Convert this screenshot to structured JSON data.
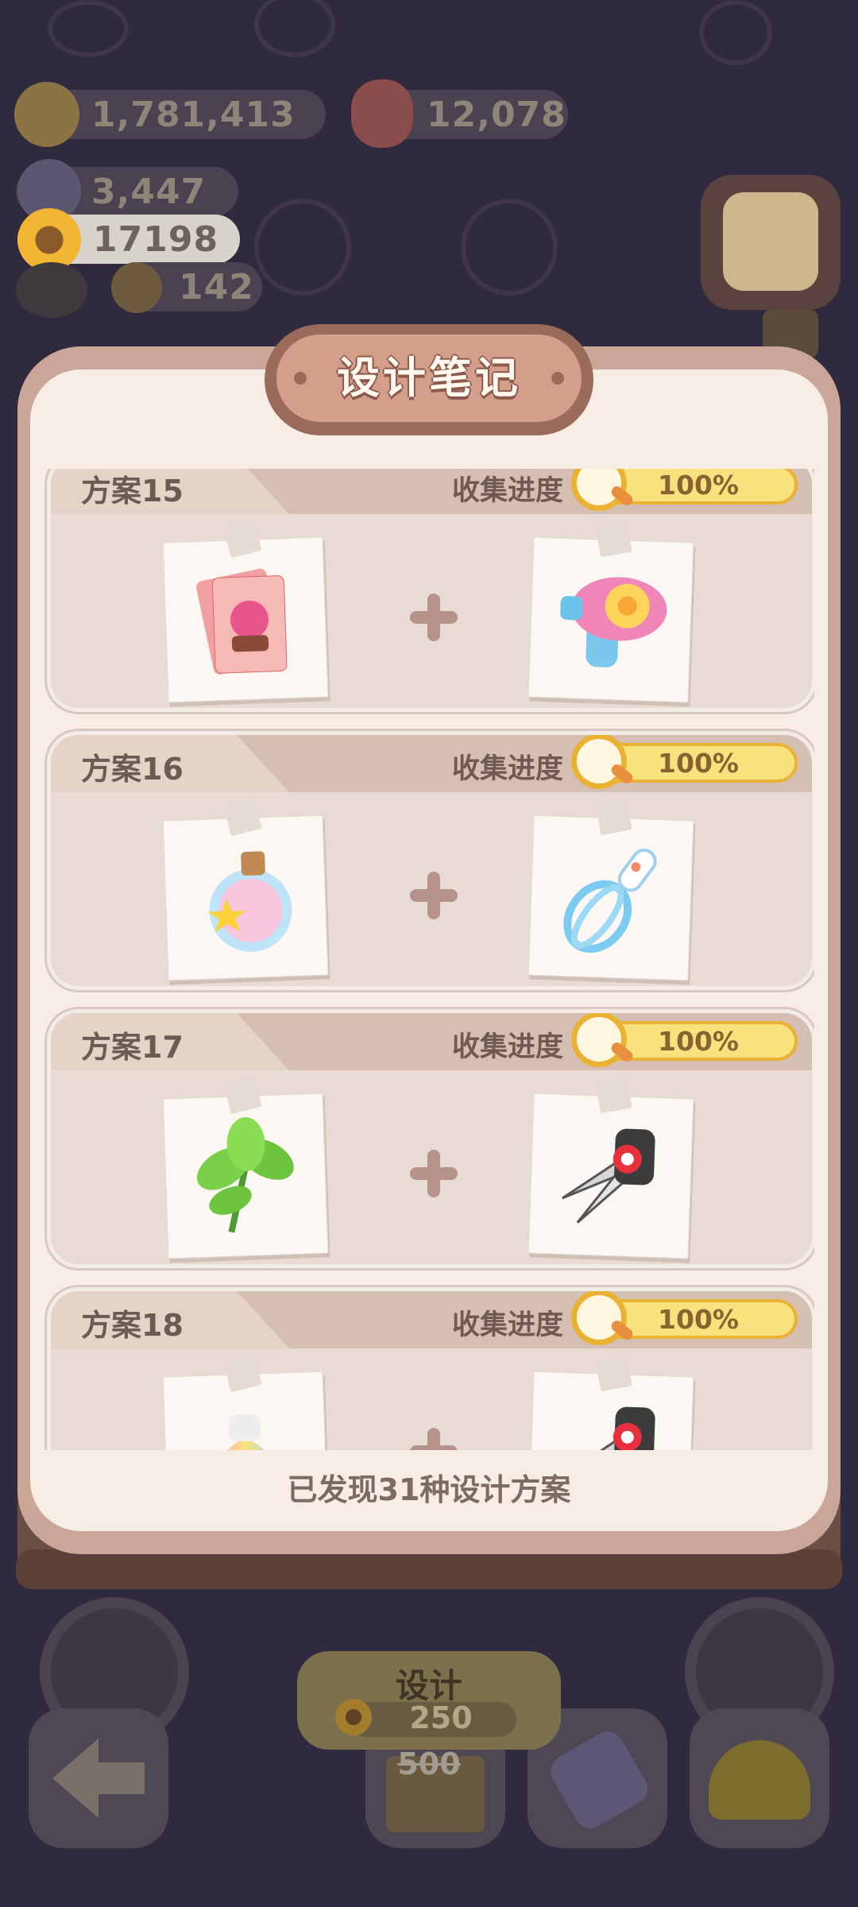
{
  "hud": {
    "coins": "1,781,413",
    "gems": "12,078",
    "crystals": "3,447",
    "sunflowers": "17198",
    "bells": "142"
  },
  "dialog": {
    "title": "设计笔记",
    "progress_label": "收集进度",
    "footer": "已发现31种设计方案",
    "plans": [
      {
        "name": "方案15",
        "progress": "100%",
        "progress_value": 1.0,
        "item_a": "yep-card-pack-icon",
        "item_b": "candy-blaster-icon"
      },
      {
        "name": "方案16",
        "progress": "100%",
        "progress_value": 1.0,
        "item_a": "star-potion-bottle-icon",
        "item_b": "blue-whisk-icon"
      },
      {
        "name": "方案17",
        "progress": "100%",
        "progress_value": 1.0,
        "item_a": "green-herb-icon",
        "item_b": "scissors-icon"
      },
      {
        "name": "方案18",
        "progress": "100%",
        "progress_value": 1.0,
        "item_a": "rainbow-bag-icon",
        "item_b": "scissors-icon"
      }
    ]
  },
  "bottom": {
    "design_label": "设计",
    "cost": "250",
    "original_cost": "500"
  },
  "colors": {
    "overlay": "#2f2a3e",
    "panel_frame": "#c9a697",
    "panel_inner": "#f7ede4",
    "progress_fill": "#f7e27e",
    "progress_border": "#e9b233"
  }
}
